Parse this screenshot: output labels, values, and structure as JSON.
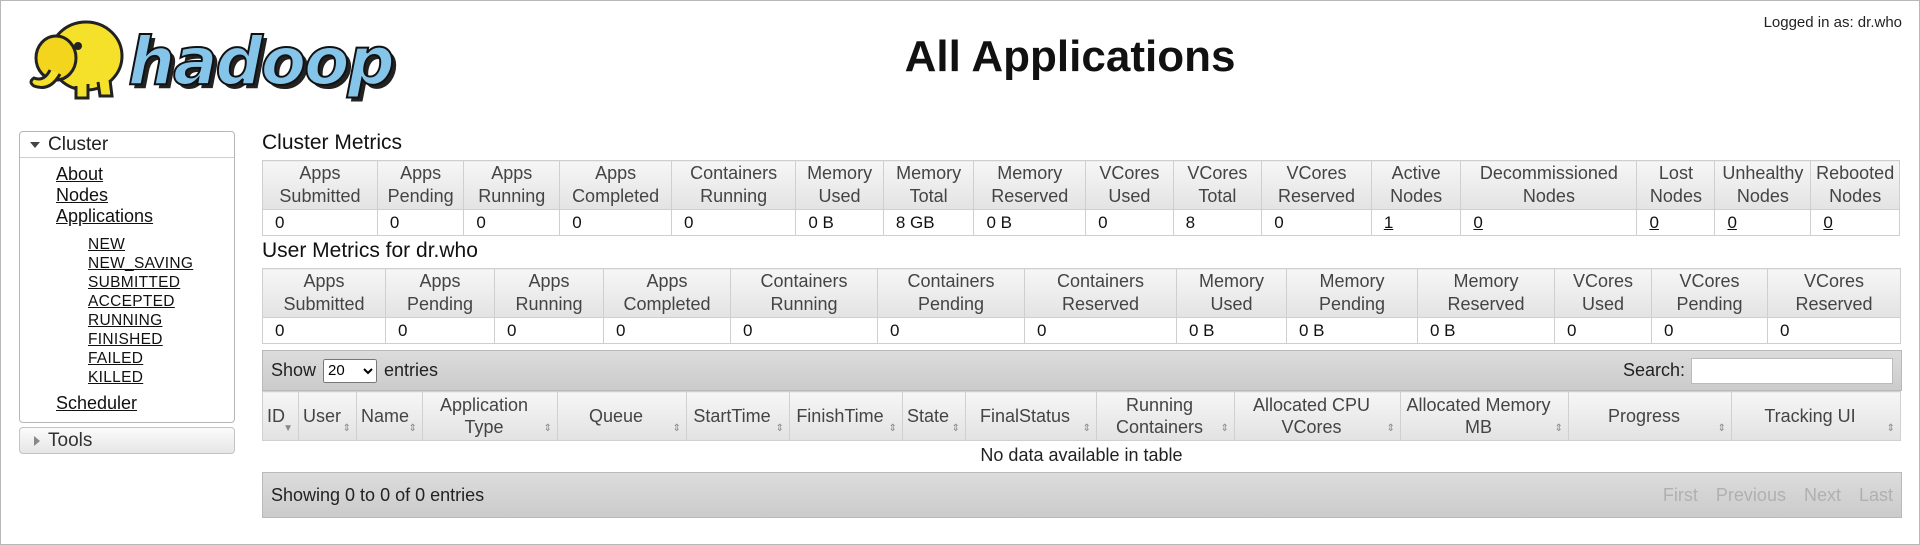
{
  "header": {
    "title": "All Applications",
    "login_label": "Logged in as: dr.who"
  },
  "sidebar": {
    "cluster_label": "Cluster",
    "cluster_links": [
      "About",
      "Nodes",
      "Applications"
    ],
    "app_states": [
      "NEW",
      "NEW_SAVING",
      "SUBMITTED",
      "ACCEPTED",
      "RUNNING",
      "FINISHED",
      "FAILED",
      "KILLED"
    ],
    "scheduler_label": "Scheduler",
    "tools_label": "Tools"
  },
  "cluster_metrics": {
    "title": "Cluster Metrics",
    "headers": [
      "Apps Submitted",
      "Apps Pending",
      "Apps Running",
      "Apps Completed",
      "Containers Running",
      "Memory Used",
      "Memory Total",
      "Memory Reserved",
      "VCores Used",
      "VCores Total",
      "VCores Reserved",
      "Active Nodes",
      "Decommissioned Nodes",
      "Lost Nodes",
      "Unhealthy Nodes",
      "Rebooted Nodes"
    ],
    "values": [
      "0",
      "0",
      "0",
      "0",
      "0",
      "0 B",
      "8 GB",
      "0 B",
      "0",
      "8",
      "0",
      "1",
      "0",
      "0",
      "0",
      "0"
    ]
  },
  "user_metrics": {
    "title": "User Metrics for dr.who",
    "headers": [
      "Apps Submitted",
      "Apps Pending",
      "Apps Running",
      "Apps Completed",
      "Containers Running",
      "Containers Pending",
      "Containers Reserved",
      "Memory Used",
      "Memory Pending",
      "Memory Reserved",
      "VCores Used",
      "VCores Pending",
      "VCores Reserved"
    ],
    "values": [
      "0",
      "0",
      "0",
      "0",
      "0",
      "0",
      "0",
      "0 B",
      "0 B",
      "0 B",
      "0",
      "0",
      "0"
    ]
  },
  "apps_table": {
    "show_label": "Show",
    "entries_label": "entries",
    "page_size": "20",
    "search_label": "Search:",
    "columns": [
      "ID",
      "User",
      "Name",
      "Application Type",
      "Queue",
      "StartTime",
      "FinishTime",
      "State",
      "FinalStatus",
      "Running Containers",
      "Allocated CPU VCores",
      "Allocated Memory MB",
      "Progress",
      "Tracking UI"
    ],
    "empty_message": "No data available in table",
    "info": "Showing 0 to 0 of 0 entries",
    "pager": [
      "First",
      "Previous",
      "Next",
      "Last"
    ]
  }
}
